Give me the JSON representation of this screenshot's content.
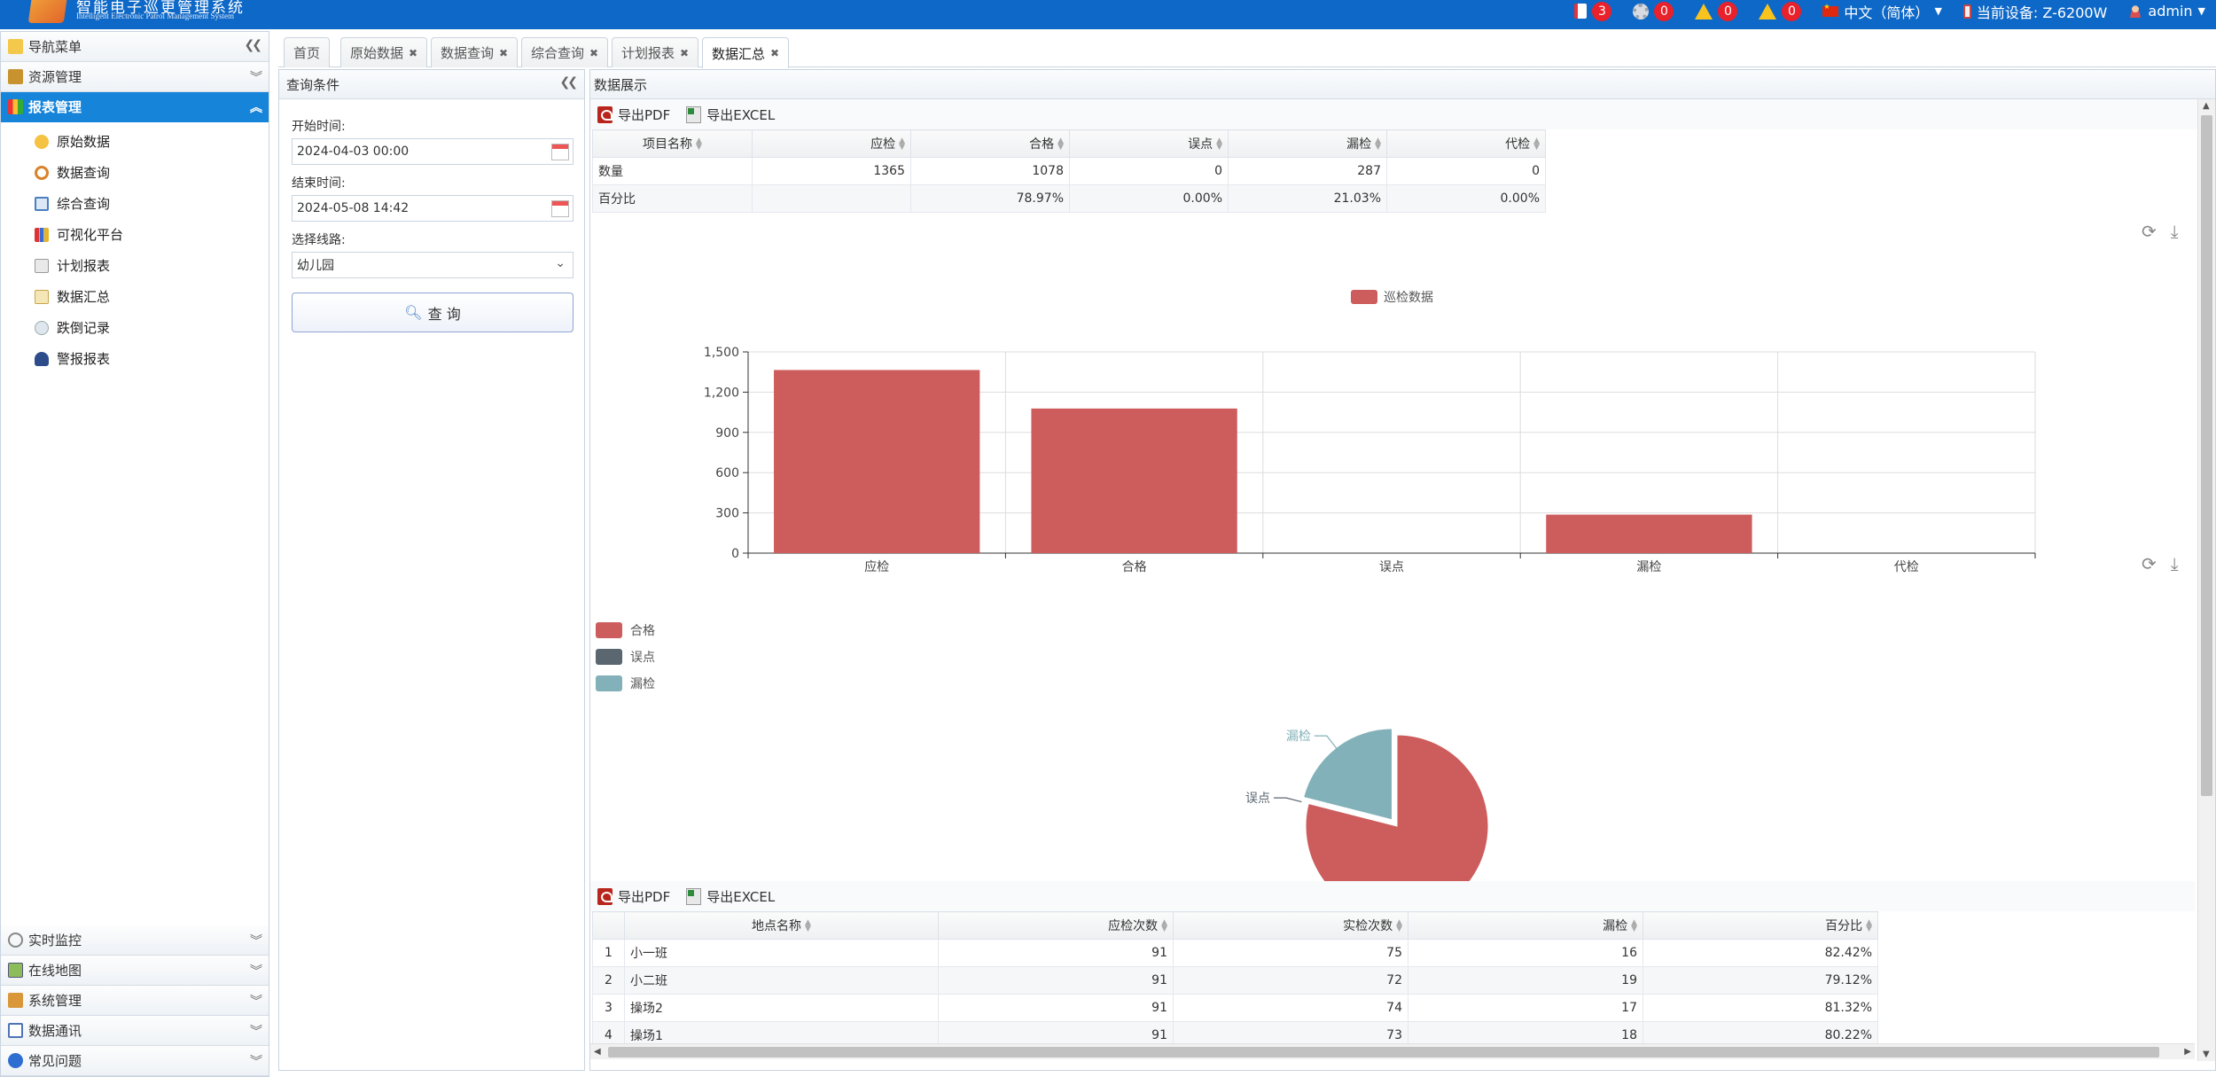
{
  "header": {
    "logo_cn": "智能电子巡更管理系统",
    "logo_en": "Intelligent Electronic Patrol Management System",
    "alerts": [
      {
        "icon": "book-alarm-icon",
        "count": "3"
      },
      {
        "icon": "gear-alarm-icon",
        "count": "0"
      },
      {
        "icon": "warning-icon",
        "count": "0"
      },
      {
        "icon": "warning-outline-icon",
        "count": "0"
      }
    ],
    "language": "中文（简体）",
    "device": "当前设备: Z-6200W",
    "user": "admin",
    "accent": "#0e68c7"
  },
  "sidebar": {
    "title": "导航菜单",
    "groups": {
      "resource": "资源管理",
      "report": "报表管理",
      "monitor": "实时监控",
      "map": "在线地图",
      "system": "系统管理",
      "comm": "数据通讯",
      "faq": "常见问题"
    },
    "report_items": [
      "原始数据",
      "数据查询",
      "综合查询",
      "可视化平台",
      "计划报表",
      "数据汇总",
      "跌倒记录",
      "警报报表"
    ]
  },
  "tabs": [
    "首页",
    "原始数据",
    "数据查询",
    "综合查询",
    "计划报表",
    "数据汇总"
  ],
  "query": {
    "title": "查询条件",
    "start_label": "开始时间:",
    "start_value": "2024-04-03 00:00",
    "end_label": "结束时间:",
    "end_value": "2024-05-08 14:42",
    "route_label": "选择线路:",
    "route_value": "幼儿园",
    "button": "查 询"
  },
  "display": {
    "title": "数据展示",
    "export_pdf": "导出PDF",
    "export_excel": "导出EXCEL",
    "summary_headers": [
      "项目名称",
      "应检",
      "合格",
      "误点",
      "漏检",
      "代检"
    ],
    "summary_rows": [
      [
        "数量",
        "1365",
        "1078",
        "0",
        "287",
        "0"
      ],
      [
        "百分比",
        "",
        "78.97%",
        "0.00%",
        "21.03%",
        "0.00%"
      ]
    ],
    "detail_headers": [
      "地点名称",
      "应检次数",
      "实检次数",
      "漏检",
      "百分比"
    ],
    "detail_rows": [
      [
        "1",
        "小一班",
        "91",
        "75",
        "16",
        "82.42%"
      ],
      [
        "2",
        "小二班",
        "91",
        "72",
        "19",
        "79.12%"
      ],
      [
        "3",
        "操场2",
        "91",
        "74",
        "17",
        "81.32%"
      ],
      [
        "4",
        "操场1",
        "91",
        "73",
        "18",
        "80.22%"
      ]
    ]
  },
  "chart_data": [
    {
      "type": "bar",
      "categories": [
        "应检",
        "合格",
        "误点",
        "漏检",
        "代检"
      ],
      "series": [
        {
          "name": "巡检数据",
          "values": [
            1365,
            1078,
            0,
            287,
            0
          ],
          "color": "#cd5c5c"
        }
      ],
      "ylim": [
        0,
        1500
      ],
      "yticks": [
        0,
        300,
        600,
        900,
        1200,
        1500
      ],
      "ytick_labels": [
        "0",
        "300",
        "600",
        "900",
        "1,200",
        "1,500"
      ],
      "grid": true,
      "legend": "top-center"
    },
    {
      "type": "pie",
      "slices": [
        {
          "label": "合格",
          "value": 1078,
          "color": "#cd5c5c"
        },
        {
          "label": "误点",
          "value": 0,
          "color": "#5a6670"
        },
        {
          "label": "漏检",
          "value": 287,
          "color": "#83b1b9"
        }
      ],
      "legend": "top-left"
    }
  ]
}
